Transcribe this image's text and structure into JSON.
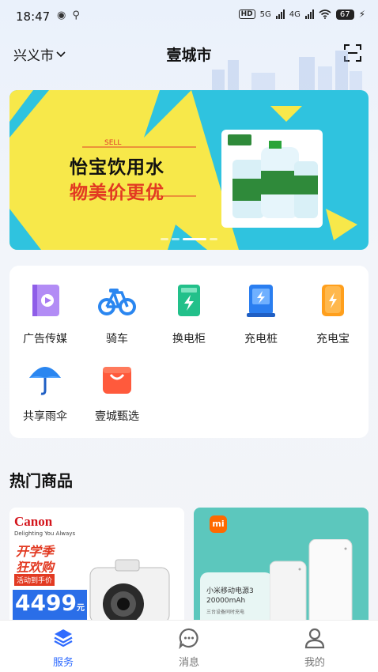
{
  "status_bar": {
    "time": "18:47",
    "network_1": "5G",
    "network_2": "4G",
    "battery": "67",
    "hd": "HD"
  },
  "header": {
    "city": "兴义市",
    "title": "壹城市"
  },
  "banner": {
    "sell": "SELL",
    "line1": "怡宝饮用水",
    "line2": "物美价更优",
    "product_brand": "怡宝",
    "active_slide": 3,
    "slide_count": 4
  },
  "services": [
    {
      "label": "广告传媒",
      "icon": "ad-media-icon"
    },
    {
      "label": "骑车",
      "icon": "bicycle-icon"
    },
    {
      "label": "换电柜",
      "icon": "battery-swap-cabinet-icon"
    },
    {
      "label": "充电桩",
      "icon": "charging-pile-icon"
    },
    {
      "label": "充电宝",
      "icon": "power-bank-icon"
    },
    {
      "label": "共享雨伞",
      "icon": "umbrella-icon"
    },
    {
      "label": "壹城甄选",
      "icon": "shopping-bag-icon"
    }
  ],
  "hot": {
    "title": "热门商品",
    "left": {
      "brand": "Canon",
      "tagline": "Delighting You Always",
      "promo1": "开学季",
      "promo2": "狂欢购",
      "promo3": "活动到手价",
      "price": "4499",
      "price_unit": "元"
    },
    "right": {
      "brand": "mi",
      "name": "小米移动电源3",
      "capacity": "20000mAh",
      "note": "三台设备同时充电"
    }
  },
  "tabbar": [
    {
      "label": "服务",
      "icon": "layers-icon",
      "active": true
    },
    {
      "label": "消息",
      "icon": "chat-icon",
      "active": false
    },
    {
      "label": "我的",
      "icon": "user-icon",
      "active": false
    }
  ],
  "colors": {
    "accent": "#2f6bff",
    "banner_bg": "#2fc3df",
    "banner_yellow": "#f7e84a",
    "promo_red": "#e23a22"
  }
}
